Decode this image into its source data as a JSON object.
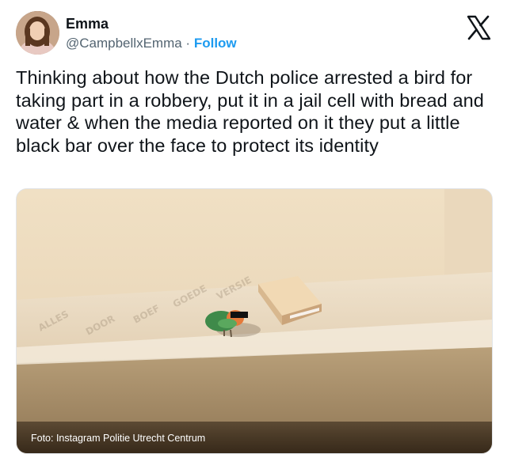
{
  "author": {
    "name": "Emma",
    "handle": "@CampbellxEmma",
    "separator": "·",
    "follow_label": "Follow",
    "avatar_icon": "user-avatar"
  },
  "platform": {
    "logo_icon": "x-logo-icon"
  },
  "tweet": {
    "text": "Thinking about how the Dutch police arrested a bird for taking part in a robbery, put it in a jail cell with bread and water & when the media reported on it they put a little black bar over the face to protect its identity"
  },
  "media": {
    "caption": "Foto: Instagram Politie Utrecht Centrum"
  },
  "colors": {
    "text": "#0f1419",
    "muted": "#536471",
    "accent": "#1d9bf0"
  }
}
